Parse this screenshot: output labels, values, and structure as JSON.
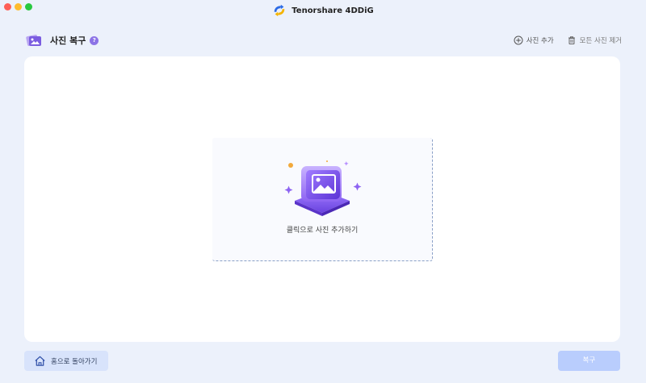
{
  "window": {
    "app_title": "Tenorshare 4DDiG",
    "buttons": [
      "close",
      "minimize",
      "maximize"
    ]
  },
  "header": {
    "title": "사진 복구",
    "help_badge": "?",
    "add_photo_label": "사진 추가",
    "remove_all_label": "모든 사진 제거",
    "icons": {
      "page": "photo-stack-icon",
      "help": "question-icon",
      "add": "plus-circle-icon",
      "remove": "trash-icon"
    }
  },
  "drop_zone": {
    "label": "클릭으로 사진 추가하기",
    "illustration": "image-upload-illustration"
  },
  "footer": {
    "home_label": "홈으로 돌아가기",
    "recover_label": "복구",
    "recover_enabled": false
  },
  "colors": {
    "background": "#ecf1fb",
    "accent_purple": "#8c73e6",
    "primary_disabled": "#b9cdfd",
    "secondary_button": "#d8e3fb"
  }
}
